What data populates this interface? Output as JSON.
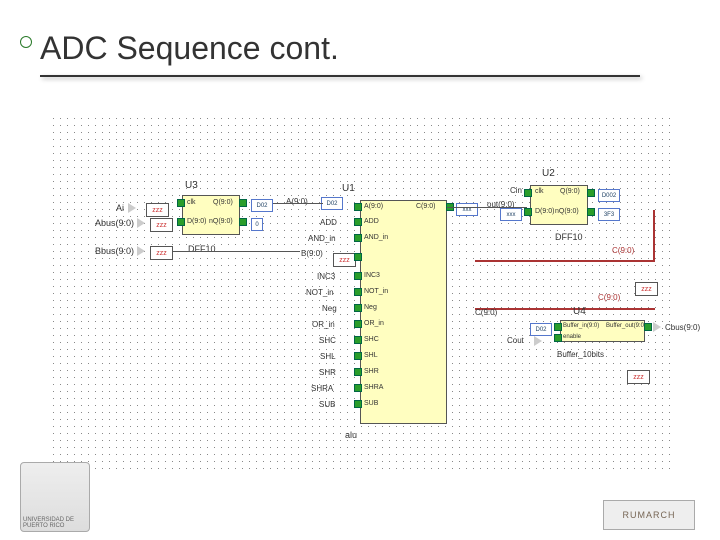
{
  "title": "ADC Sequence cont.",
  "blocks": {
    "u1": {
      "ref": "U1",
      "type": "alu"
    },
    "u2": {
      "ref": "U2",
      "type": "DFF10"
    },
    "u3": {
      "ref": "U3",
      "type": "DFF10"
    },
    "u4": {
      "ref": "U4",
      "type": "Buffer_10bits"
    }
  },
  "u3_ports": {
    "clk": "clk",
    "q": "Q(9:0)",
    "d": "D(9:0)",
    "nq": "nQ(9:0)"
  },
  "u2_ports": {
    "clk": "clk",
    "q": "Q(9:0)",
    "d": "D(9:0)",
    "nq": "nQ(9:0)"
  },
  "u1_ports": [
    {
      "left": "A(9:0)",
      "right": "A(9:0)",
      "rightout": "C(9:0)"
    },
    {
      "left": "ADD",
      "right": "ADD"
    },
    {
      "left": "AND_in",
      "right": "AND_in"
    },
    {
      "left": "B(9:0)",
      "right": ""
    },
    {
      "left": "INC3",
      "right": "INC3"
    },
    {
      "left": "NOT_in",
      "right": "NOT_in"
    },
    {
      "left": "Neg",
      "right": "Neg"
    },
    {
      "left": "OR_in",
      "right": "OR_in"
    },
    {
      "left": "SHC",
      "right": "SHC"
    },
    {
      "left": "SHL",
      "right": "SHL"
    },
    {
      "left": "SHR",
      "right": "SHR"
    },
    {
      "left": "SHRA",
      "right": "SHRA"
    },
    {
      "left": "SUB",
      "right": "SUB"
    }
  ],
  "u4_ports": {
    "in": "Buffer_in(9:0)",
    "out": "Buffer_out(9:0)",
    "en": "enable"
  },
  "signals": {
    "Ai": "Ai",
    "Abus": "Abus(9:0)",
    "Bbus": "Bbus(9:0)",
    "Cin": "Cin",
    "out": "out(9:0)",
    "C": "C(9:0)",
    "C2": "C(9:0)",
    "Cbus": "Cbus(9:0)",
    "Cout": "Cout",
    "alu": "alu"
  },
  "bus_notes": {
    "zzz": "zzz",
    "d02": "D02",
    "xxx": "xxx",
    "d002": "D002",
    "ff3f3": "3F3"
  },
  "footer": {
    "left": "UNIVERSIDAD DE PUERTO RICO",
    "right": "RUMARCH"
  }
}
